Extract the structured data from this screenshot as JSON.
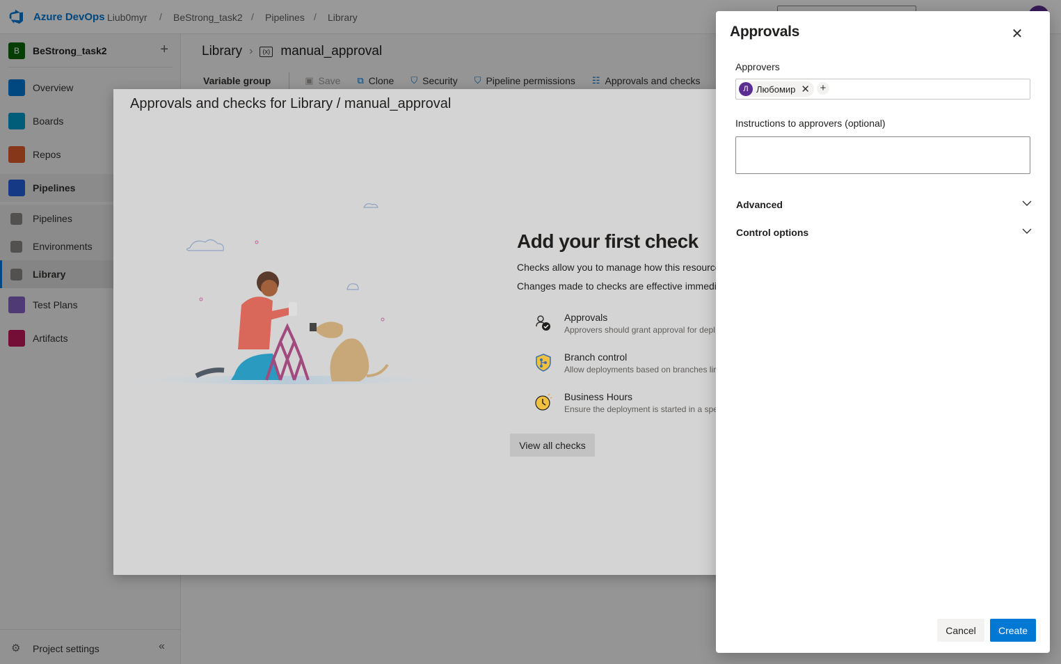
{
  "topbar": {
    "brand": "Azure DevOps",
    "breadcrumb": [
      "Liub0myr",
      "BeStrong_task2",
      "Pipelines",
      "Library"
    ],
    "separator": "/"
  },
  "sidebar": {
    "project_initial": "B",
    "project_name": "BeStrong_task2",
    "add_symbol": "+",
    "items": [
      {
        "label": "Overview",
        "icon": "overview-icon",
        "color": "#0078d4"
      },
      {
        "label": "Boards",
        "icon": "boards-icon",
        "color": "#009ccc"
      },
      {
        "label": "Repos",
        "icon": "repos-icon",
        "color": "#e05a2b"
      },
      {
        "label": "Pipelines",
        "icon": "pipelines-icon",
        "color": "#2560e0"
      },
      {
        "label": "Pipelines",
        "icon": "pipelines-sub-icon",
        "color": "#605e5c"
      },
      {
        "label": "Environments",
        "icon": "environments-icon",
        "color": "#605e5c"
      },
      {
        "label": "Library",
        "icon": "library-icon",
        "color": "#605e5c"
      },
      {
        "label": "Test Plans",
        "icon": "test-plans-icon",
        "color": "#8661c5"
      },
      {
        "label": "Artifacts",
        "icon": "artifacts-icon",
        "color": "#c2185b"
      }
    ],
    "settings_label": "Project settings",
    "collapse_symbol": "«"
  },
  "page": {
    "title": "Library",
    "item": "manual_approval",
    "variable_icon": "(x)",
    "toolbar": {
      "variable_group": "Variable group",
      "save": "Save",
      "clone": "Clone",
      "security": "Security",
      "pipeline_permissions": "Pipeline permissions",
      "approvals_checks": "Approvals and checks"
    }
  },
  "checks_modal": {
    "title": "Approvals and checks for Library / manual_approval",
    "heading": "Add your first check",
    "desc1": "Checks allow you to manage how this resource",
    "desc2": "Changes made to checks are effective immedia",
    "checks": [
      {
        "name": "Approvals",
        "desc": "Approvers should grant approval for depl",
        "icon": "approvals-icon"
      },
      {
        "name": "Branch control",
        "desc": "Allow deployments based on branches lir",
        "icon": "branch-control-icon"
      },
      {
        "name": "Business Hours",
        "desc": "Ensure the deployment is started in a spec",
        "icon": "business-hours-icon"
      }
    ],
    "view_all": "View all checks"
  },
  "approvals_panel": {
    "title": "Approvals",
    "approvers_label": "Approvers",
    "approver": {
      "initial": "Л",
      "name": "Любомир"
    },
    "remove_symbol": "✕",
    "add_symbol": "+",
    "instructions_label": "Instructions to approvers (optional)",
    "instructions_value": "",
    "advanced": "Advanced",
    "control_options": "Control options",
    "cancel": "Cancel",
    "create": "Create"
  },
  "colors": {
    "accent": "#0078d4",
    "avatar": "#5c2d91",
    "project_badge": "#0b6a0b"
  }
}
